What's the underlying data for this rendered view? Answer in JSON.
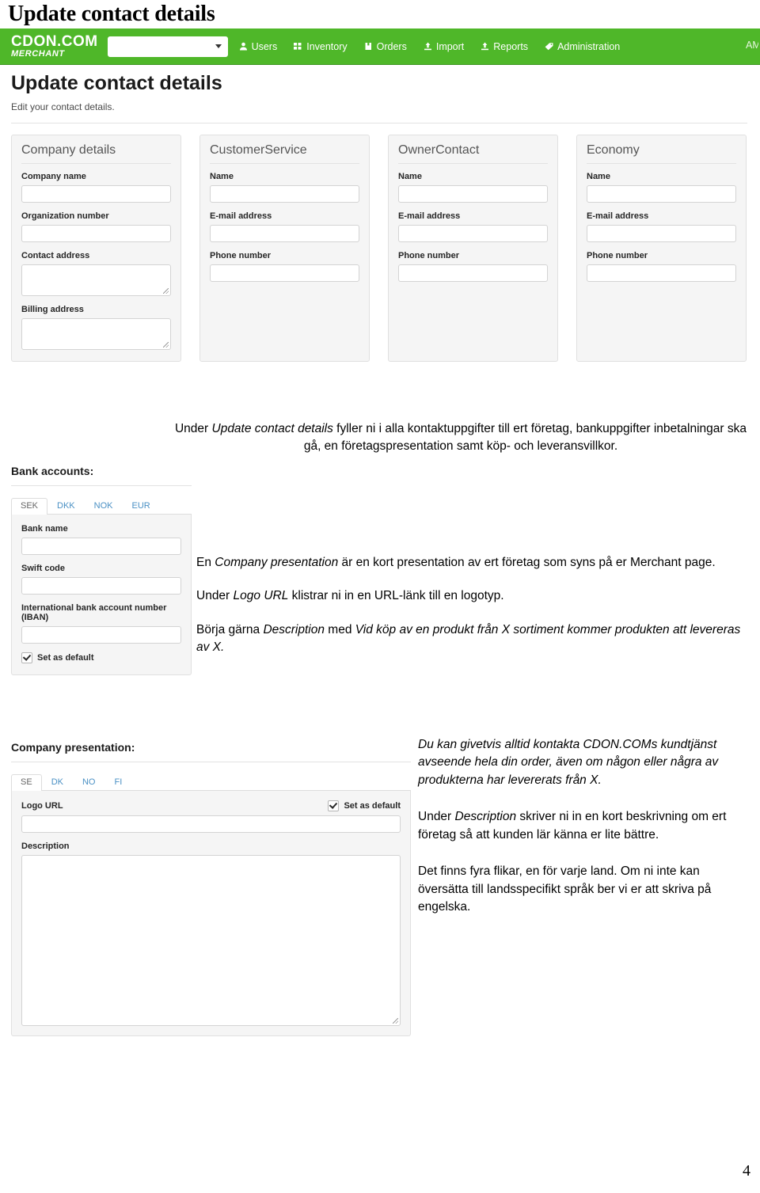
{
  "document": {
    "heading": "Update contact details",
    "page_number": "4"
  },
  "screenshot": {
    "navbar": {
      "brand_line1": "CDON.COM",
      "brand_line2": "MERCHANT",
      "store_select_value": "",
      "store_select_placeholder": "",
      "links": [
        {
          "label": "Users",
          "icon": "user-icon"
        },
        {
          "label": "Inventory",
          "icon": "grid-icon"
        },
        {
          "label": "Orders",
          "icon": "box-icon"
        },
        {
          "label": "Import",
          "icon": "upload-icon"
        },
        {
          "label": "Reports",
          "icon": "upload-icon"
        },
        {
          "label": "Administration",
          "icon": "tag-icon"
        }
      ],
      "right_text": "AM",
      "bg_color": "#4fb729"
    },
    "page": {
      "title": "Update contact details",
      "subtitle": "Edit your contact details."
    },
    "cards": [
      {
        "title": "Company details",
        "fields": [
          {
            "label": "Company name",
            "type": "input",
            "value": ""
          },
          {
            "label": "Organization number",
            "type": "input",
            "value": ""
          },
          {
            "label": "Contact address",
            "type": "textarea",
            "value": ""
          },
          {
            "label": "Billing address",
            "type": "textarea",
            "value": ""
          }
        ]
      },
      {
        "title": "CustomerService",
        "fields": [
          {
            "label": "Name",
            "type": "input",
            "value": ""
          },
          {
            "label": "E-mail address",
            "type": "input",
            "value": ""
          },
          {
            "label": "Phone number",
            "type": "input",
            "value": ""
          }
        ]
      },
      {
        "title": "OwnerContact",
        "fields": [
          {
            "label": "Name",
            "type": "input",
            "value": ""
          },
          {
            "label": "E-mail address",
            "type": "input",
            "value": ""
          },
          {
            "label": "Phone number",
            "type": "input",
            "value": ""
          }
        ]
      },
      {
        "title": "Economy",
        "fields": [
          {
            "label": "Name",
            "type": "input",
            "value": ""
          },
          {
            "label": "E-mail address",
            "type": "input",
            "value": ""
          },
          {
            "label": "Phone number",
            "type": "input",
            "value": ""
          }
        ]
      }
    ],
    "bank_section": {
      "title": "Bank accounts:",
      "tabs": [
        "SEK",
        "DKK",
        "NOK",
        "EUR"
      ],
      "active_tab": "SEK",
      "fields": [
        {
          "label": "Bank name",
          "value": ""
        },
        {
          "label": "Swift code",
          "value": ""
        },
        {
          "label": "International bank account number (IBAN)",
          "value": ""
        }
      ],
      "checkbox_label": "Set as default",
      "checkbox_checked": true
    },
    "presentation_section": {
      "title": "Company presentation:",
      "tabs": [
        "SE",
        "DK",
        "NO",
        "FI"
      ],
      "active_tab": "SE",
      "logo_label": "Logo URL",
      "logo_value": "",
      "checkbox_label": "Set as default",
      "checkbox_checked": true,
      "description_label": "Description",
      "description_value": ""
    }
  },
  "prose": {
    "intro": {
      "lead": "Under ",
      "em1": "Update contact details",
      "rest": " fyller ni i alla kontaktuppgifter till ert företag, bankuppgifter inbetalningar ska gå, en företagspresentation samt köp- och leveransvillkor."
    },
    "para_presentation": {
      "lead": "En ",
      "em1": "Company presentation",
      "rest": " är en kort presentation av ert företag som syns på er Merchant page."
    },
    "para_logo": {
      "lead": "Under ",
      "em1": "Logo URL",
      "rest": " klistrar ni in en URL-länk till en logotyp."
    },
    "para_description_start": {
      "lead": "Börja gärna ",
      "em1": "Description",
      "mid": " med  ",
      "em2": "Vid köp av en produkt från X sortiment kommer produkten att levereras av X."
    },
    "para_support": "Du kan givetvis alltid kontakta CDON.COMs kundtjänst avseende hela din order, även om någon eller några av produkterna har levererats från X.",
    "para_description": {
      "lead": "Under ",
      "em1": "Description",
      "rest": " skriver ni in en kort beskrivning om ert företag så att kunden lär känna er lite bättre."
    },
    "para_tabs": "Det finns fyra flikar, en för varje land. Om ni inte kan översätta till landsspecifikt språk ber vi er att skriva på engelska."
  }
}
